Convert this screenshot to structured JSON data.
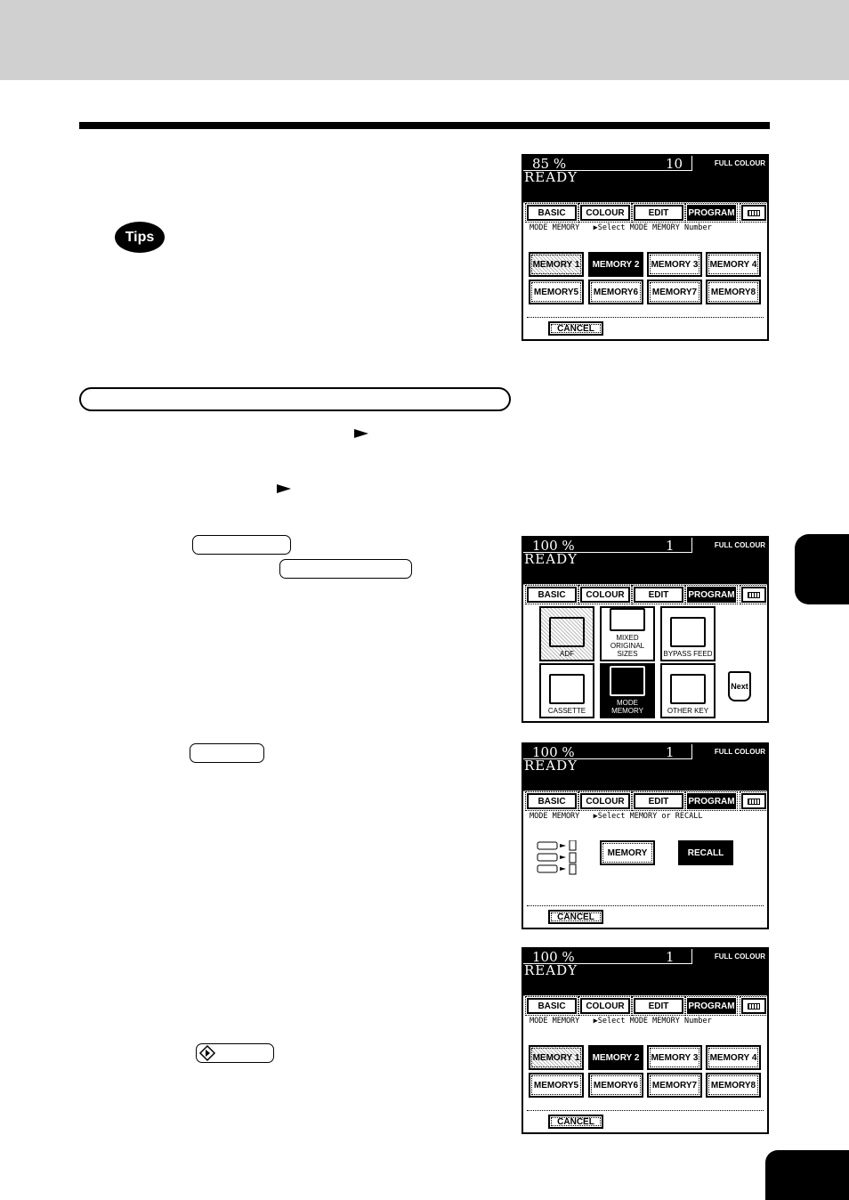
{
  "badge": {
    "tips": "Tips"
  },
  "screens": [
    {
      "type": "memory",
      "percent": "85  %",
      "count": "10",
      "colour": "FULL COLOUR",
      "status": "READY",
      "tabs": [
        "BASIC",
        "COLOUR",
        "EDIT",
        "PROGRAM",
        "keyboard-icon"
      ],
      "active_tab": 3,
      "info": "MODE MEMORY   ▶Select MODE MEMORY Number",
      "buttons": [
        "MEMORY 1",
        "MEMORY 2",
        "MEMORY 3",
        "MEMORY 4",
        "MEMORY5",
        "MEMORY6",
        "MEMORY7",
        "MEMORY8"
      ],
      "selected": 1,
      "hatched": 0,
      "cancel": "CANCEL"
    },
    {
      "type": "program",
      "percent": "100  %",
      "count": "1",
      "colour": "FULL COLOUR",
      "status": "READY",
      "tabs": [
        "BASIC",
        "COLOUR",
        "EDIT",
        "PROGRAM",
        "keyboard-icon"
      ],
      "active_tab": 3,
      "buttons": [
        "ADF",
        "MIXED ORIGINAL SIZES",
        "BYPASS FEED",
        "CASSETTE",
        "MODE MEMORY",
        "OTHER KEY"
      ],
      "icons": [
        "adf-icon",
        "mixed-sizes-icon",
        "bypass-feed-icon",
        "cassette-icon",
        "mode-memory-icon",
        "other-key-icon"
      ],
      "selected": 4,
      "hatched": 0,
      "next": "Next"
    },
    {
      "type": "recall",
      "percent": "100  %",
      "count": "1",
      "colour": "FULL COLOUR",
      "status": "READY",
      "tabs": [
        "BASIC",
        "COLOUR",
        "EDIT",
        "PROGRAM",
        "keyboard-icon"
      ],
      "active_tab": 3,
      "info": "MODE MEMORY   ▶Select MEMORY or RECALL",
      "buttons": [
        "MEMORY",
        "RECALL"
      ],
      "selected": 1,
      "cancel": "CANCEL"
    },
    {
      "type": "memory",
      "percent": "100  %",
      "count": "1",
      "colour": "FULL COLOUR",
      "status": "READY",
      "tabs": [
        "BASIC",
        "COLOUR",
        "EDIT",
        "PROGRAM",
        "keyboard-icon"
      ],
      "active_tab": 3,
      "info": "MODE MEMORY   ▶Select MODE MEMORY Number",
      "buttons": [
        "MEMORY 1",
        "MEMORY 2",
        "MEMORY 3",
        "MEMORY 4",
        "MEMORY5",
        "MEMORY6",
        "MEMORY7",
        "MEMORY8"
      ],
      "selected": 1,
      "hatched": 0,
      "cancel": "CANCEL"
    }
  ]
}
